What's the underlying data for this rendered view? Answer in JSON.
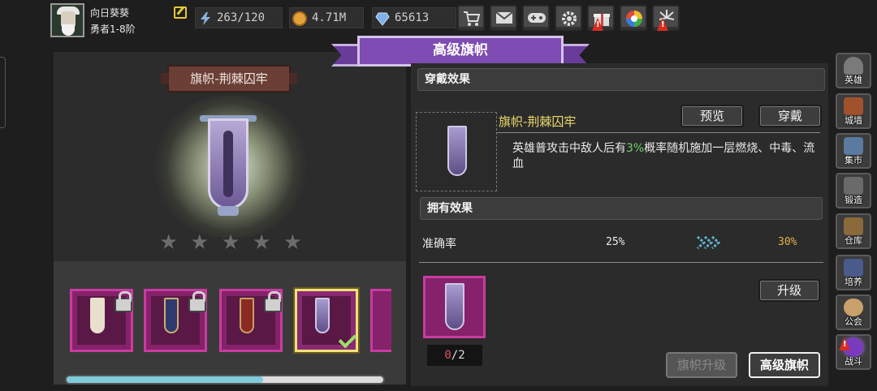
{
  "player": {
    "name": "向日葵葵",
    "rank": "勇者1-8阶"
  },
  "resources": [
    {
      "icon": "energy-icon",
      "value": "263/120",
      "color": "#8ab4e0"
    },
    {
      "icon": "gold-coin-icon",
      "value": "4.71M",
      "color": "#e6a23a"
    },
    {
      "icon": "gem-icon",
      "value": "65613",
      "color": "#7fb0e6"
    }
  ],
  "top_buttons": [
    {
      "icon": "shop-cart-icon",
      "alert": false
    },
    {
      "icon": "mail-icon",
      "alert": false
    },
    {
      "icon": "gamepad-icon",
      "alert": false
    },
    {
      "icon": "settings-gear-icon",
      "alert": false
    },
    {
      "icon": "gift-icon",
      "alert": true
    },
    {
      "icon": "color-wheel-icon",
      "alert": false
    },
    {
      "icon": "firework-icon",
      "alert": true
    }
  ],
  "title": "高级旗帜",
  "banner": {
    "name": "旗帜-荆棘囚牢",
    "stars_total": 5,
    "stars_filled": 0
  },
  "banner_slots": [
    {
      "name": "white-banner",
      "locked": true,
      "color": "#e8e0cc",
      "selected": false
    },
    {
      "name": "moon-banner",
      "locked": true,
      "color": "#2e3a6e",
      "selected": false
    },
    {
      "name": "sword-banner",
      "locked": true,
      "color": "#8a2a22",
      "selected": false
    },
    {
      "name": "thorn-prison-banner",
      "locked": false,
      "color": "#8a7cb8",
      "selected": true
    }
  ],
  "scroll_progress": 0.62,
  "wear_effect": {
    "heading": "穿戴效果",
    "item_name": "旗帜-荆棘囚牢",
    "preview_label": "预览",
    "equip_label": "穿戴",
    "desc_before": "英雄普攻击中敌人后有",
    "desc_highlight": "3%",
    "desc_after": "概率随机施加一层燃烧、中毒、流血"
  },
  "own_effect": {
    "heading": "拥有效果",
    "stat_name": "准确率",
    "current": "25%",
    "next": "30%"
  },
  "upgrade": {
    "button_label": "升级",
    "material_have": "0",
    "material_need": "/2"
  },
  "bottom_tabs": {
    "banner_upgrade": "旗帜升级",
    "advanced_banner": "高级旗帜"
  },
  "nav": [
    {
      "label": "英雄",
      "icon": "hero-helmet-icon",
      "color": "#7a7a7a"
    },
    {
      "label": "城墙",
      "icon": "castle-wall-icon",
      "color": "#a0522d"
    },
    {
      "label": "集市",
      "icon": "market-stall-icon",
      "color": "#5a7aa0"
    },
    {
      "label": "锻造",
      "icon": "anvil-icon",
      "color": "#6a6a6a"
    },
    {
      "label": "仓库",
      "icon": "warehouse-icon",
      "color": "#8a6a3a"
    },
    {
      "label": "培养",
      "icon": "training-icon",
      "color": "#4a5a8a"
    },
    {
      "label": "公会",
      "icon": "guild-icon",
      "color": "#c8a06a"
    },
    {
      "label": "战斗",
      "icon": "battle-portal-icon",
      "color": "#7a3ac0"
    }
  ]
}
